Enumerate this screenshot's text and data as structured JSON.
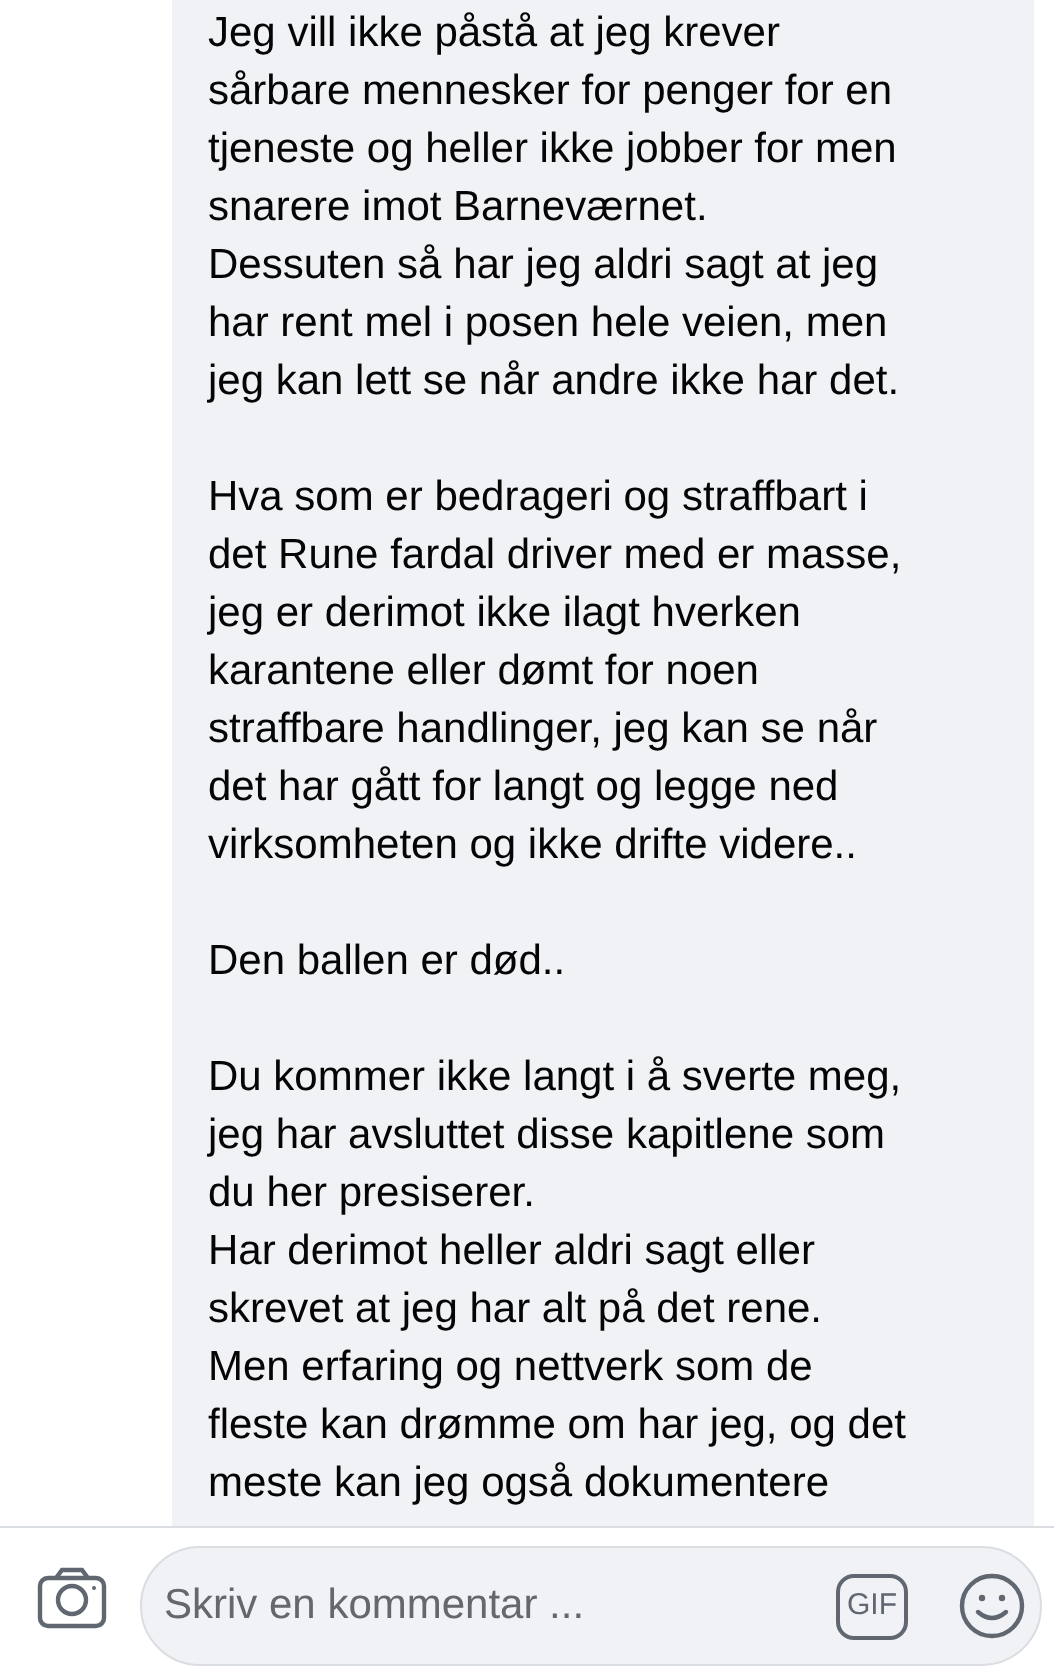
{
  "comment": {
    "paragraphs": [
      {
        "lines": [
          "Jeg vill ikke påstå at jeg krever",
          "sårbare mennesker for penger for en",
          "tjeneste og heller ikke jobber for men",
          "snarere imot Barneværnet.",
          "Dessuten så har jeg aldri sagt at jeg",
          "har rent mel i posen hele veien, men",
          "jeg kan lett se når andre ikke har det."
        ]
      },
      {
        "lines": [
          "Hva som er bedrageri og straffbart i",
          "det Rune fardal driver med er masse,",
          "jeg er derimot ikke ilagt hverken",
          "karantene eller dømt for noen",
          "straffbare handlinger, jeg kan se når",
          "det har gått for langt og legge ned",
          "virksomheten og ikke drifte videre.."
        ]
      },
      {
        "lines": [
          "Den ballen er død.."
        ]
      },
      {
        "lines": [
          "Du kommer ikke langt i å sverte meg,",
          "jeg har avsluttet disse kapitlene som",
          "du her presiserer.",
          "Har derimot heller aldri sagt eller",
          "skrevet at jeg har alt på det rene.",
          "Men erfaring og nettverk som de",
          "fleste kan drømme om har jeg, og det",
          "meste kan jeg også dokumentere"
        ]
      }
    ]
  },
  "composer": {
    "placeholder": "Skriv en kommentar ...",
    "gif_label": "GIF"
  }
}
